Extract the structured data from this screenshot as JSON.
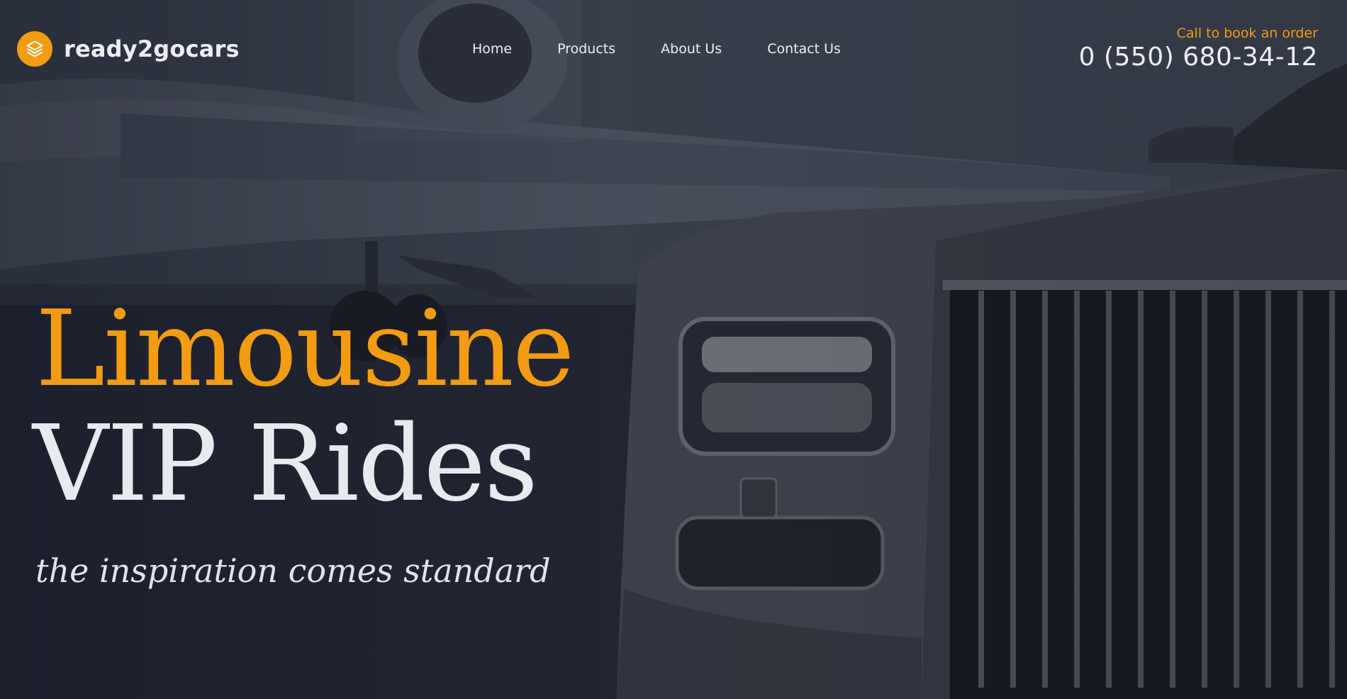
{
  "brand": {
    "name": "ready2gocars",
    "accent_color": "#f39c12",
    "logo_icon": "layers-icon"
  },
  "nav": {
    "items": [
      {
        "label": "Home"
      },
      {
        "label": "Products"
      },
      {
        "label": "About Us"
      },
      {
        "label": "Contact Us"
      }
    ]
  },
  "contact": {
    "label": "Call to book an order",
    "phone": "0 (550) 680-34-12"
  },
  "hero": {
    "headline_primary": "Limousine",
    "headline_secondary": "VIP Rides",
    "tagline": "the inspiration comes standard"
  }
}
